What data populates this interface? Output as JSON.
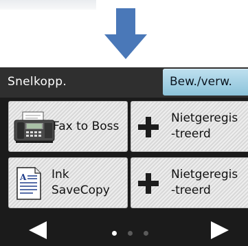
{
  "header": {
    "title": "Snelkopp.",
    "edit_button_label": "Bew./verw."
  },
  "shortcuts": [
    {
      "label": "Fax to Boss",
      "icon": "fax-machine-icon"
    },
    {
      "label_line1": "Nietgeregis",
      "label_line2": "-treerd",
      "icon": "plus-icon"
    },
    {
      "label_line1": "Ink",
      "label_line2": "SaveCopy",
      "icon": "document-icon"
    },
    {
      "label_line1": "Nietgeregis",
      "label_line2": "-treerd",
      "icon": "plus-icon"
    }
  ],
  "pagination": {
    "current_page": 1,
    "total_pages": 3
  },
  "colors": {
    "screen_bg": "#1b1b1b",
    "header_bg": "#2f2f2f",
    "edit_button": "#a6d3e6",
    "arrow_blue": "#4a78b8"
  }
}
